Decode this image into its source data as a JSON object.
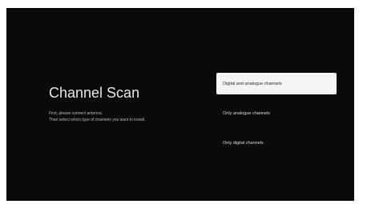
{
  "screen": {
    "title": "Channel Scan",
    "description_line1": "First, please connect antenna.",
    "description_line2": "Then select which type of channels you want to install."
  },
  "options": [
    {
      "label": "Digital and analogue channels",
      "selected": true
    },
    {
      "label": "Only analogue channels",
      "selected": false
    },
    {
      "label": "Only digital channels",
      "selected": false
    }
  ],
  "colors": {
    "background": "#0a0a0a",
    "selected_bg": "#f4f4f4",
    "text": "#dcdcdc"
  }
}
